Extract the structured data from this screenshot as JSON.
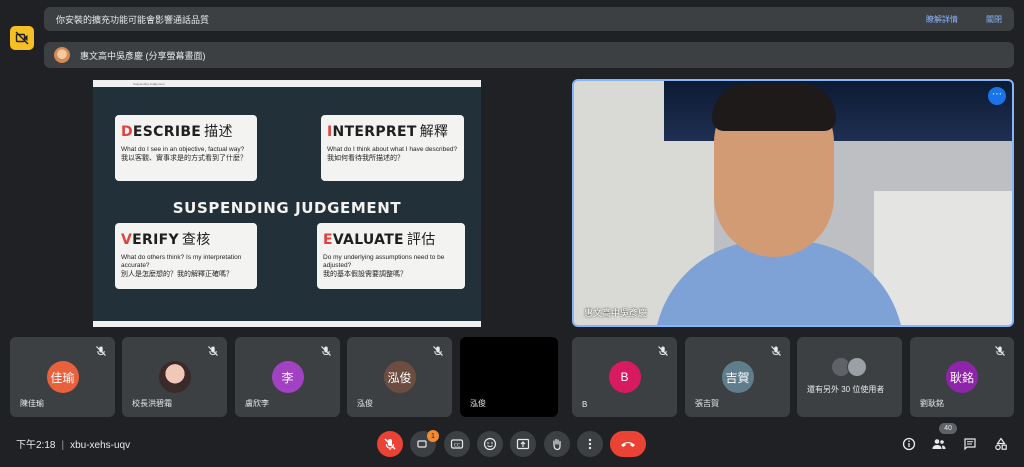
{
  "banner": {
    "warning": "你安裝的擴充功能可能會影響通話品質",
    "learn_more": "瞭解詳情",
    "dismiss": "關閉",
    "presenter": "惠文高中吳彥慶 (分享螢幕畫面)"
  },
  "slide": {
    "top_caption": "Suspending Judgement",
    "describe": {
      "first": "D",
      "rest": "ESCRIBE",
      "cn": "描述",
      "en": "What do I see in an objective, factual way?",
      "zh": "我以客觀、實事求是的方式看到了什麼？"
    },
    "interpret": {
      "first": "I",
      "rest": "NTERPRET",
      "cn": "解釋",
      "en": "What do I think about what I have described?",
      "zh": "我如何看待我所描述的？"
    },
    "center": "SUSPENDING JUDGEMENT",
    "verify": {
      "first": "V",
      "rest": "ERIFY",
      "cn": "查核",
      "en": "What do others think? Is my interpretation accurate?",
      "zh": "別人是怎麼想的？我的解釋正確嗎？"
    },
    "evaluate": {
      "first": "E",
      "rest": "VALUATE",
      "cn": "評估",
      "en": "Do my underlying assumptions need to be adjusted?",
      "zh": "我的基本假設需要調整嗎？"
    }
  },
  "speaker": {
    "name": "惠文高中吳彥慶"
  },
  "participants": [
    {
      "initials": "佳瑜",
      "name": "陳佳瑜",
      "color": "#e8603c"
    },
    {
      "initials": "",
      "name": "校長洪碧霜",
      "color": "#f1c8b8"
    },
    {
      "initials": "李",
      "name": "盧欣李",
      "color": "#a142c3"
    },
    {
      "initials": "泓俊",
      "name": "泓俊",
      "color": "#6d4c41"
    },
    {
      "initials": "",
      "name": "泓俊",
      "color": "#000000"
    },
    {
      "initials": "B",
      "name": "B",
      "color": "#d81b60"
    },
    {
      "initials": "吉賀",
      "name": "張吉賀",
      "color": "#607d8b"
    },
    {
      "initials": "",
      "name": "還有另外 30 位使用者",
      "color": "#3c4043"
    },
    {
      "initials": "耿銘",
      "name": "劉耿銘",
      "color": "#8e24aa"
    }
  ],
  "footer": {
    "time": "下午2:18",
    "meeting_code": "xbu-xehs-uqv",
    "notification_count": "1",
    "people_count": "40"
  }
}
